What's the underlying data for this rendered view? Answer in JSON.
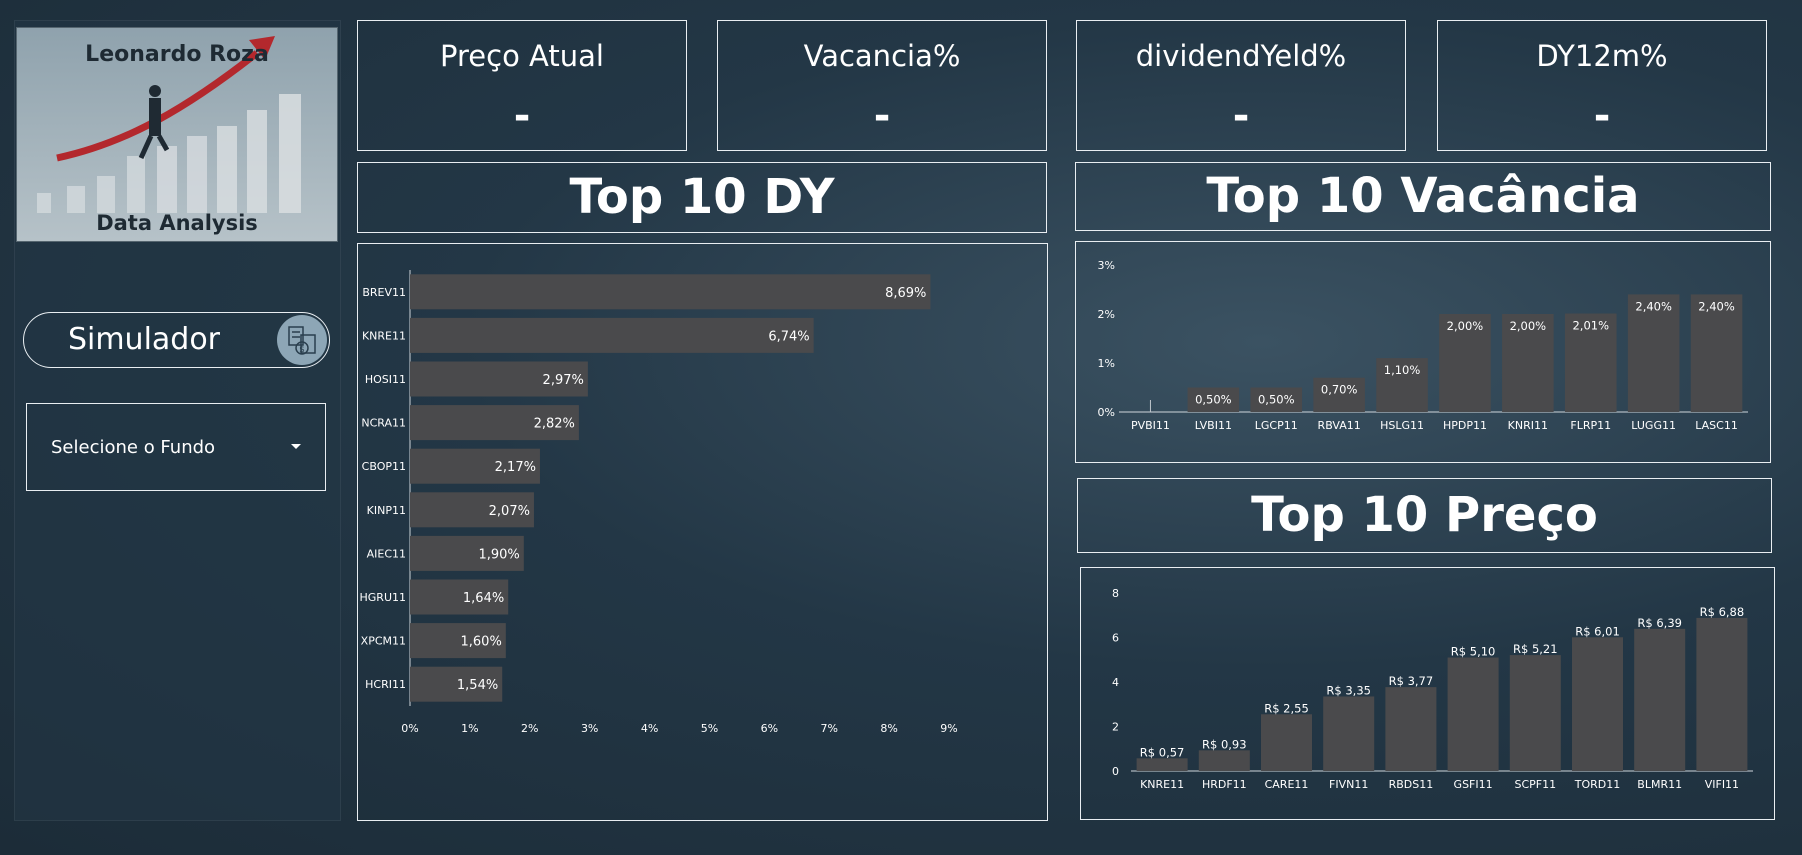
{
  "sidebar": {
    "logo_title": "Leonardo Roza",
    "logo_subtitle": "Data Analysis",
    "simulator_label": "Simulador",
    "fund_select_value": "Selecione o Fundo"
  },
  "kpis": [
    {
      "label": "Preço Atual",
      "value": "-"
    },
    {
      "label": "Vacancia%",
      "value": "-"
    },
    {
      "label": "dividendYeld%",
      "value": "-"
    },
    {
      "label": "DY12m%",
      "value": "-"
    }
  ],
  "colors": {
    "bar": "#4a4a4c",
    "border": "#e9eef2",
    "background": "#233746"
  },
  "chart_data": [
    {
      "type": "bar",
      "orientation": "horizontal",
      "title": "Top 10 DY",
      "categories": [
        "BREV11",
        "KNRE11",
        "HOSI11",
        "NCRA11",
        "CBOP11",
        "KINP11",
        "AIEC11",
        "HGRU11",
        "XPCM11",
        "HCRI11"
      ],
      "values": [
        8.69,
        6.74,
        2.97,
        2.82,
        2.17,
        2.07,
        1.9,
        1.64,
        1.6,
        1.54
      ],
      "data_labels": [
        "8,69%",
        "6,74%",
        "2,97%",
        "2,82%",
        "2,17%",
        "2,07%",
        "1,90%",
        "1,64%",
        "1,60%",
        "1,54%"
      ],
      "xlim": [
        0,
        9
      ],
      "x_ticks": [
        "0%",
        "1%",
        "2%",
        "3%",
        "4%",
        "5%",
        "6%",
        "7%",
        "8%",
        "9%"
      ]
    },
    {
      "type": "bar",
      "title": "Top 10 Vacância",
      "categories": [
        "PVBI11",
        "LVBI11",
        "LGCP11",
        "RBVA11",
        "HSLG11",
        "HPDP11",
        "KNRI11",
        "FLRP11",
        "LUGG11",
        "LASC11"
      ],
      "values": [
        0.0,
        0.5,
        0.5,
        0.7,
        1.1,
        2.0,
        2.0,
        2.01,
        2.4,
        2.4
      ],
      "data_labels": [
        "",
        "0,50%",
        "0,50%",
        "0,70%",
        "1,10%",
        "2,00%",
        "2,00%",
        "2,01%",
        "2,40%",
        "2,40%"
      ],
      "ylim": [
        0,
        3
      ],
      "y_ticks": [
        "0%",
        "1%",
        "2%",
        "3%"
      ]
    },
    {
      "type": "bar",
      "title": "Top 10 Preço",
      "categories": [
        "KNRE11",
        "HRDF11",
        "CARE11",
        "FIVN11",
        "RBDS11",
        "GSFI11",
        "SCPF11",
        "TORD11",
        "BLMR11",
        "VIFI11"
      ],
      "values": [
        0.57,
        0.93,
        2.55,
        3.35,
        3.77,
        5.1,
        5.21,
        6.01,
        6.39,
        6.88
      ],
      "data_labels": [
        "R$ 0,57",
        "R$ 0,93",
        "R$ 2,55",
        "R$ 3,35",
        "R$ 3,77",
        "R$ 5,10",
        "R$ 5,21",
        "R$ 6,01",
        "R$ 6,39",
        "R$ 6,88"
      ],
      "ylim": [
        0,
        8
      ],
      "y_ticks": [
        "0",
        "2",
        "4",
        "6",
        "8"
      ]
    }
  ]
}
